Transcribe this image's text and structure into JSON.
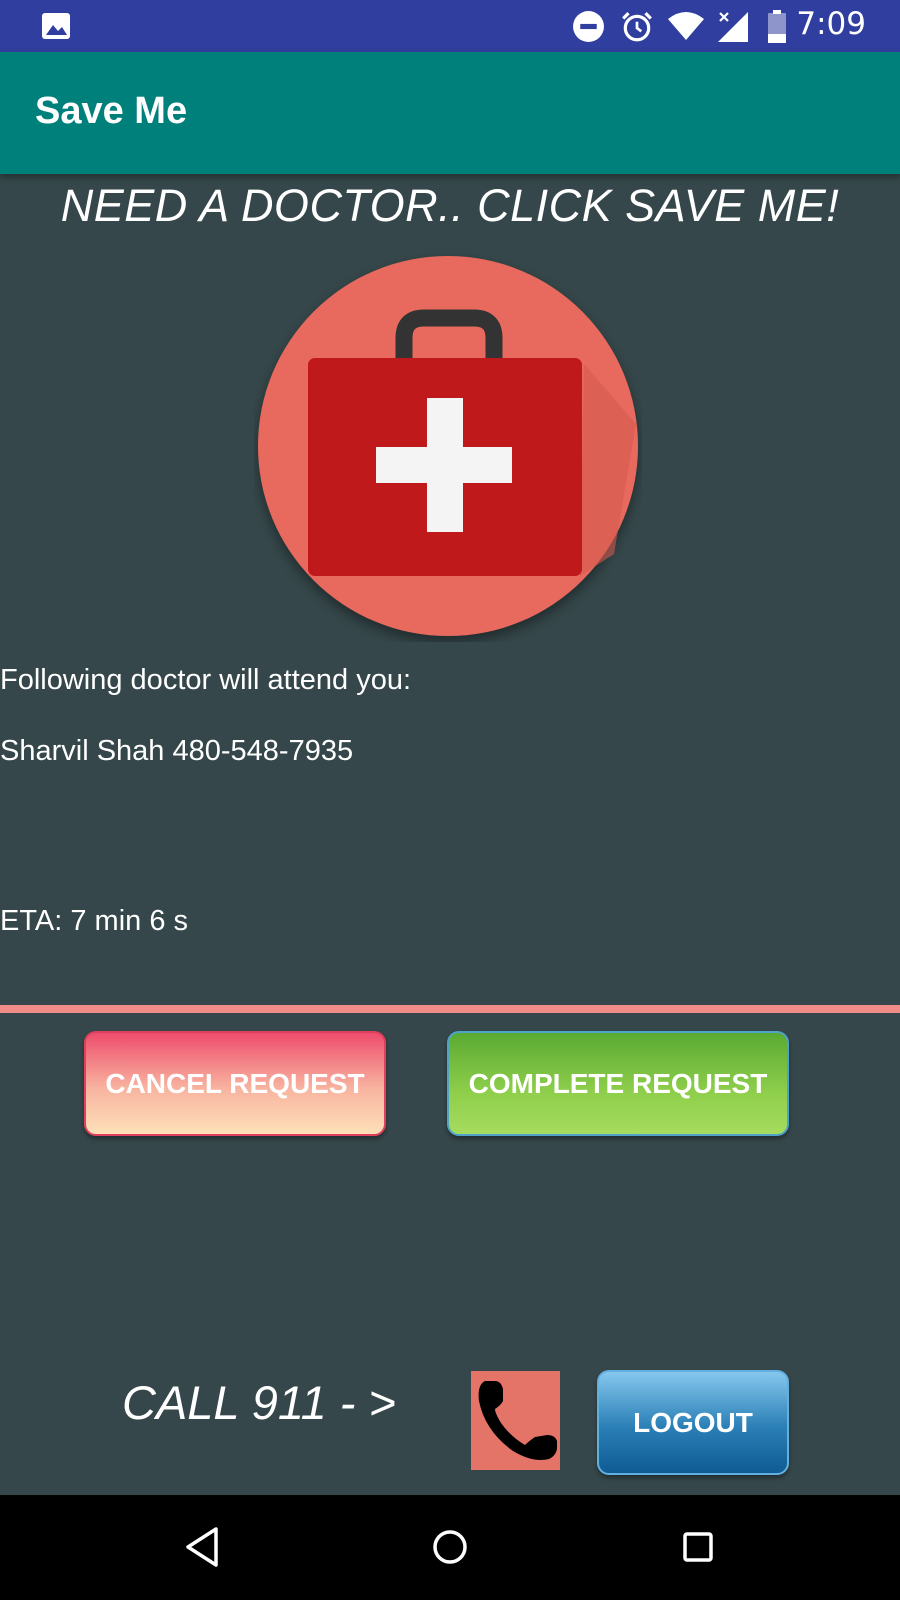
{
  "status_bar": {
    "time": "7:09",
    "icons": [
      "image-notification-icon",
      "do-not-disturb-icon",
      "alarm-icon",
      "wifi-icon",
      "cell-signal-icon",
      "battery-icon"
    ]
  },
  "app_bar": {
    "title": "Save Me"
  },
  "main": {
    "headline": "NEED A DOCTOR.. CLICK SAVE ME!",
    "save_me_icon": "first-aid-kit-icon",
    "doctor_intro": "Following doctor will attend you:",
    "doctor_info": "Sharvil Shah 480-548-7935",
    "eta": "ETA: 7 min 6 s"
  },
  "actions": {
    "cancel_label": "CANCEL REQUEST",
    "complete_label": "COMPLETE REQUEST"
  },
  "footer": {
    "call_label": "CALL 911 - >",
    "phone_icon": "phone-icon",
    "logout_label": "LOGOUT"
  },
  "nav_bar": {
    "icons": [
      "back-icon",
      "home-icon",
      "recents-icon"
    ]
  },
  "colors": {
    "status_bar": "#303f9f",
    "app_bar": "#00807a",
    "background": "#35474a",
    "divider": "#f08d88",
    "medkit_circle": "#e8695d",
    "medkit_case": "#c0191b"
  }
}
